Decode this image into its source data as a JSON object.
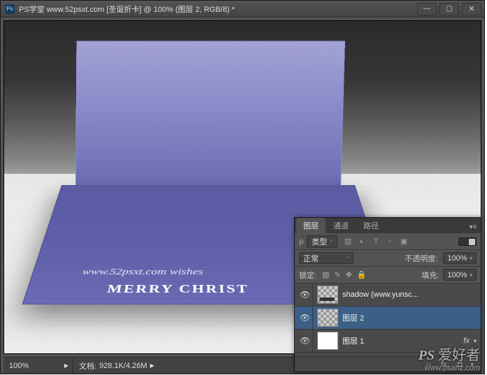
{
  "window": {
    "title": "PS学堂 www.52psxt.com [圣诞折卡] @ 100% (图层 2, RGB/8) *"
  },
  "canvas": {
    "card_text1": "www.52psxt.com   wishes",
    "card_text2": "MERRY CHRIST"
  },
  "statusbar": {
    "zoom": "100%",
    "doc_label": "文档:",
    "doc_size": "928.1K/4.26M"
  },
  "layers_panel": {
    "tabs": [
      {
        "label": "图层",
        "active": true
      },
      {
        "label": "通道",
        "active": false
      },
      {
        "label": "路径",
        "active": false
      }
    ],
    "filter": {
      "kind_label": "类型"
    },
    "blend": {
      "mode": "正常",
      "opacity_label": "不透明度:",
      "opacity_value": "100%"
    },
    "lock": {
      "label": "锁定:",
      "fill_label": "填充:",
      "fill_value": "100%"
    },
    "layers": [
      {
        "name": "shadow (www.yunsc...",
        "thumb": "checker-shadow"
      },
      {
        "name": "图层 2",
        "thumb": "checker",
        "selected": true
      },
      {
        "name": "图层 1",
        "thumb": "white",
        "fx": true
      }
    ]
  },
  "watermark": {
    "brand": "PS 爱好者",
    "url": "www.psahz.com"
  }
}
